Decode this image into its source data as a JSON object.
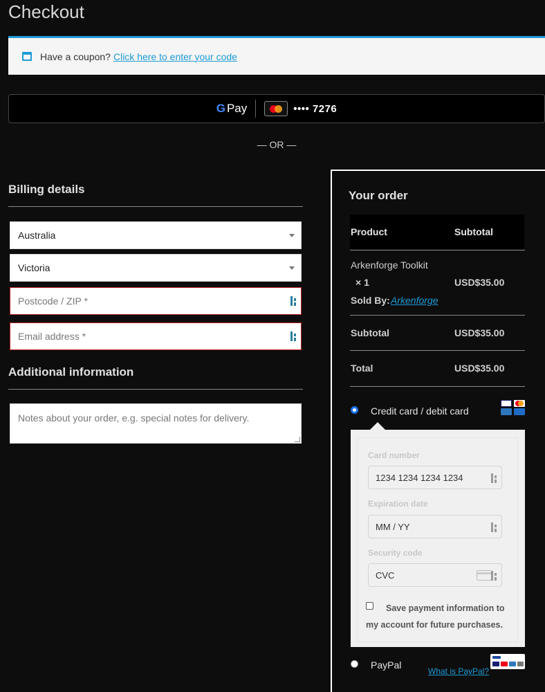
{
  "page": {
    "title": "Checkout"
  },
  "coupon": {
    "prefix": "Have a coupon?",
    "link": "Click here to enter your code"
  },
  "express_pay": {
    "brand": "Pay",
    "card_mask": "•••• 7276"
  },
  "separator": "— OR —",
  "billing": {
    "heading": "Billing details",
    "country": "Australia",
    "state": "Victoria",
    "postcode_placeholder": "Postcode / ZIP *",
    "email_placeholder": "Email address *"
  },
  "additional": {
    "heading": "Additional information",
    "notes_placeholder": "Notes about your order, e.g. special notes for delivery."
  },
  "order": {
    "heading": "Your order",
    "col_product": "Product",
    "col_subtotal": "Subtotal",
    "item_name": "Arkenforge Toolkit",
    "item_qty": "× 1",
    "item_price": "USD$35.00",
    "sold_by_label": "Sold By:",
    "sold_by_vendor": "Arkenforge",
    "subtotal_label": "Subtotal",
    "subtotal_value": "USD$35.00",
    "total_label": "Total",
    "total_value": "USD$35.00"
  },
  "payment": {
    "card_option": "Credit card / debit card",
    "card_number_label": "Card number",
    "card_number_placeholder": "1234 1234 1234 1234",
    "expiry_label": "Expiration date",
    "expiry_placeholder": "MM / YY",
    "cvc_label": "Security code",
    "cvc_placeholder": "CVC",
    "save_text": "Save payment information to my account for future purchases.",
    "paypal_option": "PayPal",
    "paypal_link": "What is PayPal?"
  },
  "colors": {
    "accent": "#1e9bd7",
    "radio_selected": "#1a73e8",
    "background": "#0d0d0d"
  }
}
